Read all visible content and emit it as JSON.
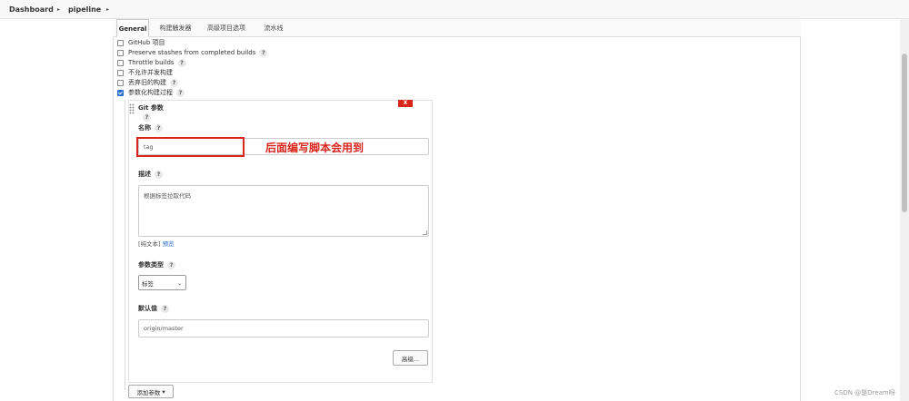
{
  "breadcrumb": {
    "items": [
      "Dashboard",
      "pipeline"
    ],
    "separator": "▸"
  },
  "tabs": [
    {
      "label": "General",
      "active": true
    },
    {
      "label": "构建触发器",
      "active": false
    },
    {
      "label": "高级项目选项",
      "active": false
    },
    {
      "label": "流水线",
      "active": false
    }
  ],
  "options": [
    {
      "label": "GitHub 项目",
      "checked": false,
      "help": false
    },
    {
      "label": "Preserve stashes from completed builds",
      "checked": false,
      "help": true
    },
    {
      "label": "Throttle builds",
      "checked": false,
      "help": true
    },
    {
      "label": "不允许并发构建",
      "checked": false,
      "help": false
    },
    {
      "label": "丢弃旧的构建",
      "checked": false,
      "help": true
    },
    {
      "label": "参数化构建过程",
      "checked": true,
      "help": true
    }
  ],
  "help_glyph": "?",
  "param": {
    "title": "Git 参数",
    "delete_label": "X",
    "name_label": "名称",
    "name_value": "tag",
    "annotation": "后面编写脚本会用到",
    "desc_label": "描述",
    "desc_value": "根据标签拉取代码",
    "plain_text": "[纯文本]",
    "preview_link": "预览",
    "type_label": "参数类型",
    "type_value": "标签",
    "default_label": "默认值",
    "default_value": "origin/master",
    "advanced_button": "高级...",
    "accent_color": "#d9261c"
  },
  "add_param_button": "添加参数",
  "add_param_chevron": "▾",
  "select_chevron": "⌄",
  "watermark": "CSDN @是Dream呀"
}
